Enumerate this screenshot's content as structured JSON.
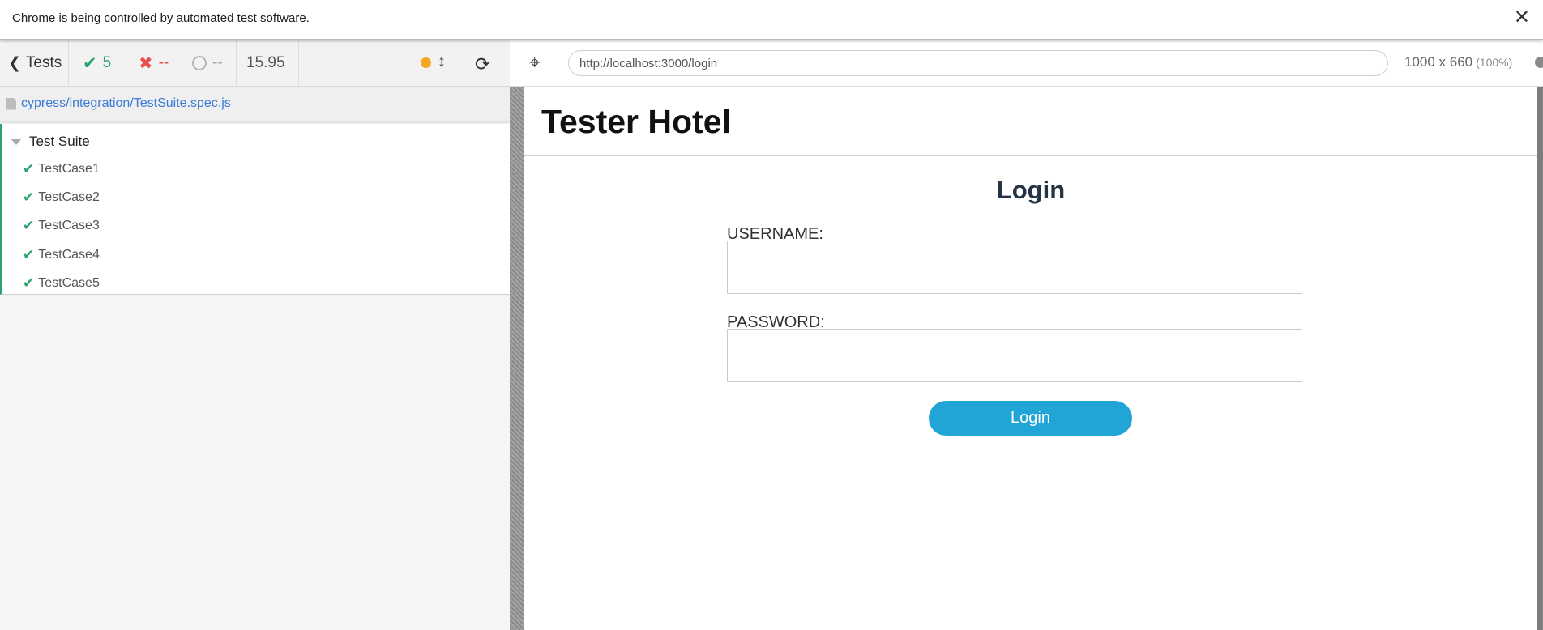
{
  "browser": {
    "automation_notice": "Chrome is being controlled by automated test software.",
    "close_glyph": "✕"
  },
  "reporter": {
    "tests_label": "Tests",
    "passed_count": "5",
    "failed_count": "--",
    "pending_count": "--",
    "duration": "15.95",
    "spec_path": "cypress/integration/TestSuite.spec.js",
    "suite": {
      "title": "Test Suite",
      "tests": [
        {
          "title": "TestCase1",
          "state": "passed"
        },
        {
          "title": "TestCase2",
          "state": "passed"
        },
        {
          "title": "TestCase3",
          "state": "passed"
        },
        {
          "title": "TestCase4",
          "state": "passed"
        },
        {
          "title": "TestCase5",
          "state": "passed"
        }
      ]
    },
    "colors": {
      "passed": "#29a36a",
      "failed": "#e94f4f",
      "running_dot": "#f5a623"
    }
  },
  "runner": {
    "url": "http://localhost:3000/login",
    "viewport": "1000 x 660",
    "scale": "(100%)"
  },
  "app": {
    "title": "Tester Hotel",
    "login_heading": "Login",
    "username_label": "USERNAME:",
    "username_value": "",
    "password_label": "PASSWORD:",
    "password_value": "",
    "login_button": "Login",
    "colors": {
      "button": "#21a5d6",
      "heading": "#253444"
    }
  }
}
